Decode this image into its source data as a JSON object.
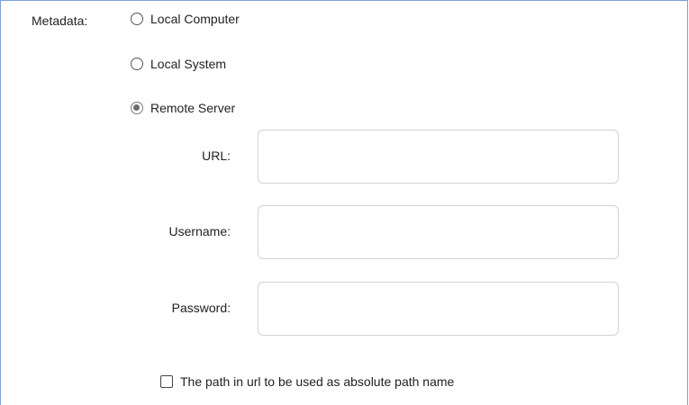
{
  "metadata": {
    "label": "Metadata:",
    "options": [
      {
        "label": "Local Computer",
        "selected": false
      },
      {
        "label": "Local System",
        "selected": false
      },
      {
        "label": "Remote Server",
        "selected": true
      }
    ]
  },
  "remote": {
    "url_label": "URL:",
    "url_value": "",
    "username_label": "Username:",
    "username_value": "",
    "password_label": "Password:",
    "password_value": ""
  },
  "absolute_path": {
    "label": "The path in url to be used as absolute path name",
    "checked": false
  },
  "colors": {
    "panel_border": "#7f9fd3",
    "input_border": "#cfd3d8",
    "text": "#222222"
  }
}
